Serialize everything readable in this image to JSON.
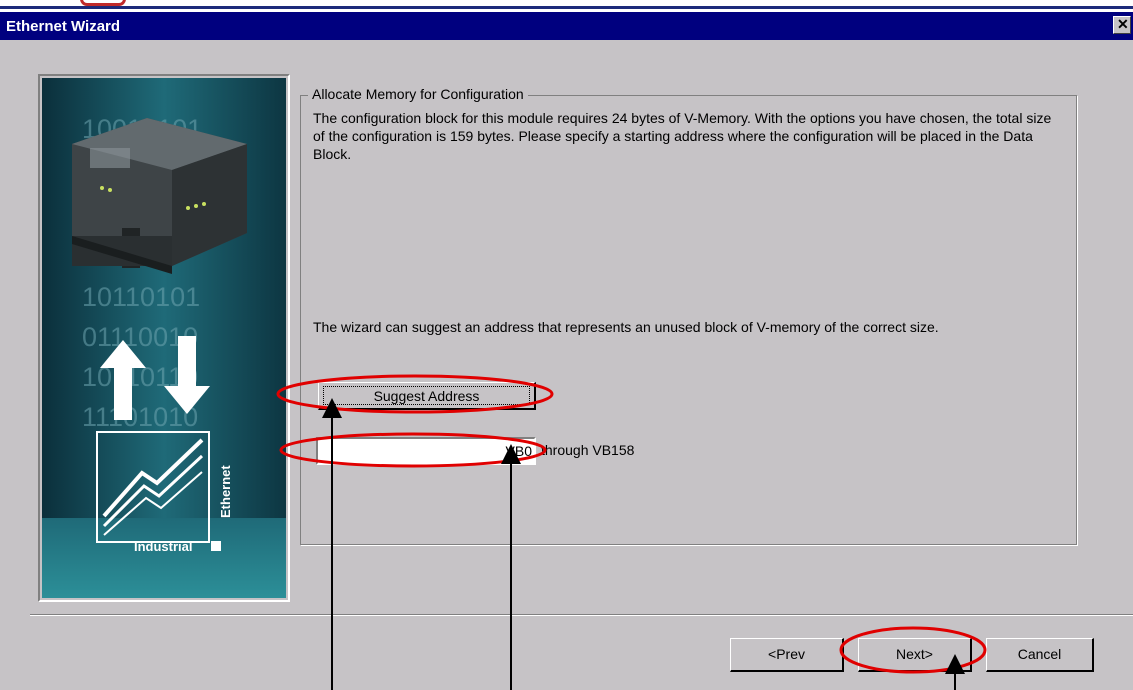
{
  "window": {
    "title": "Ethernet Wizard",
    "close_glyph": "✕"
  },
  "sidebar_image": {
    "binary_rows": [
      "10010101",
      "10110101",
      "01110010",
      "10110110",
      "11101010"
    ],
    "brand_vertical": "Ethernet",
    "brand_horizontal": "Industrial"
  },
  "section": {
    "title": "Allocate Memory for Configuration",
    "description": "The configuration block for this module requires 24 bytes of V-Memory. With the options you have chosen, the total size of the configuration is 159 bytes. Please specify a starting address where the configuration will be placed in the Data Block.",
    "suggest_text": "The wizard can suggest an address that represents an unused block of V-memory of the correct size.",
    "suggest_button_label": "Suggest Address",
    "start_address_value": "VB0",
    "through_label": "through VB158"
  },
  "nav": {
    "prev_label": "<Prev",
    "next_label": "Next>",
    "cancel_label": "Cancel"
  },
  "annotation": {
    "color": "#e00000",
    "arrow_color": "#000000"
  }
}
